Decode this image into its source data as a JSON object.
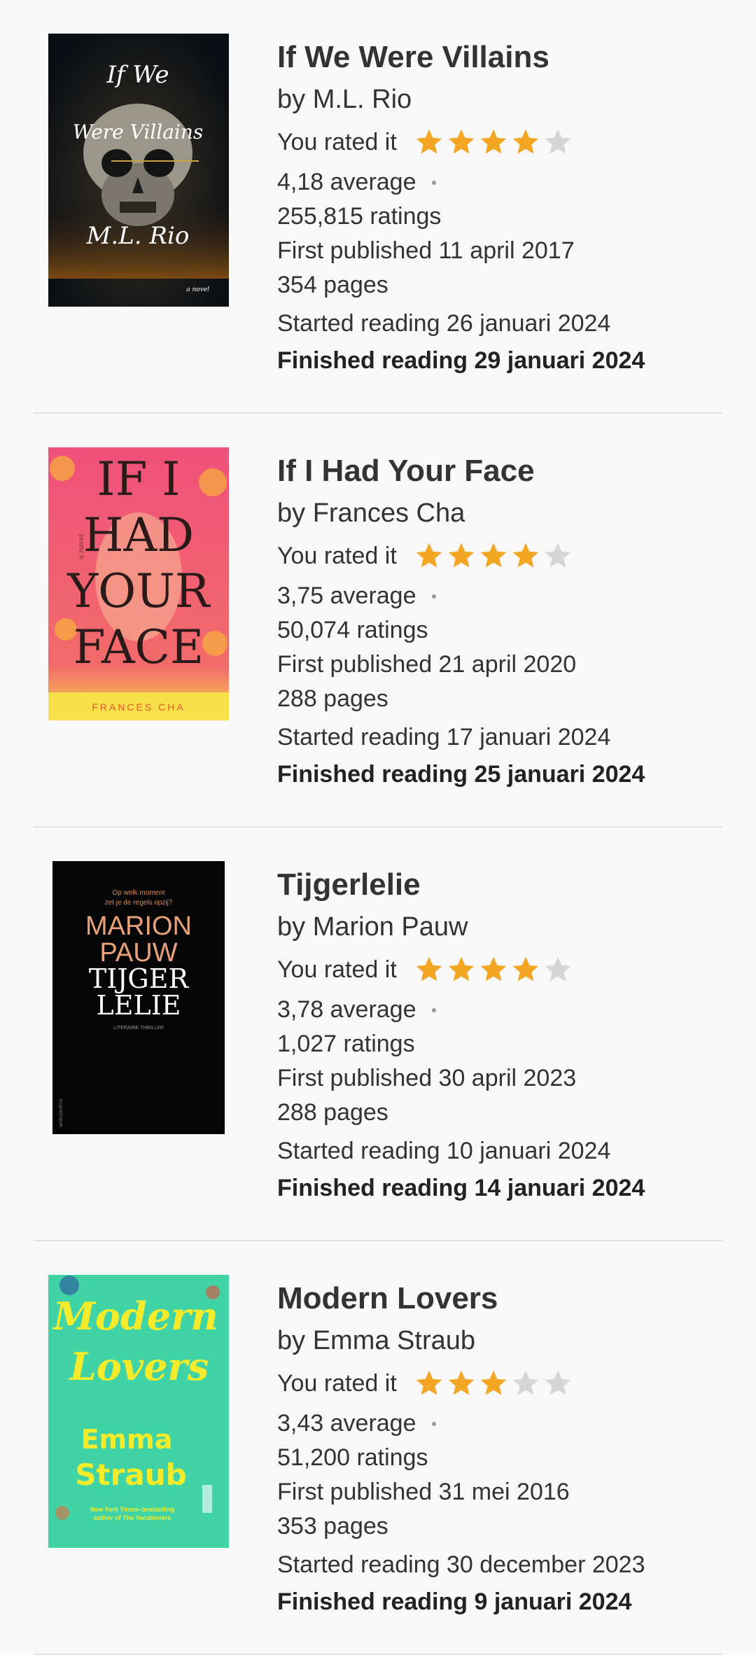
{
  "colors": {
    "star_filled": "#f2a623",
    "star_empty": "#d6d6d6",
    "divider": "#e3e3e3",
    "background": "#f8f8f8"
  },
  "books": [
    {
      "cover_text": [
        "If We",
        "Were Villains",
        "M.L. Rio",
        "a novel"
      ],
      "title": "If We Were Villains",
      "author": "by M.L. Rio",
      "rated_label": "You rated it",
      "rating": 4,
      "average": "4,18 average",
      "ratings": "255,815 ratings",
      "published": "First published 11 april 2017",
      "pages": "354 pages",
      "started": "Started reading 26 januari 2024",
      "finished": "Finished reading 29 januari 2024"
    },
    {
      "cover_text": [
        "IF I",
        "HAD",
        "YOUR",
        "FACE",
        "FRANCES CHA",
        "a novel"
      ],
      "title": "If I Had Your Face",
      "author": "by Frances Cha",
      "rated_label": "You rated it",
      "rating": 4,
      "average": "3,75 average",
      "ratings": "50,074 ratings",
      "published": "First published 21 april 2020",
      "pages": "288 pages",
      "started": "Started reading 17 januari 2024",
      "finished": "Finished reading 25 januari 2024"
    },
    {
      "cover_text": [
        "Op welk moment",
        "zet je de regels opzij?",
        "MARION",
        "PAUW",
        "TIJGER",
        "LELIE",
        "LITERAIRE THRILLER",
        "ambo|anthos"
      ],
      "title": "Tijgerlelie",
      "author": "by Marion Pauw",
      "rated_label": "You rated it",
      "rating": 4,
      "average": "3,78 average",
      "ratings": "1,027 ratings",
      "published": "First published 30 april 2023",
      "pages": "288 pages",
      "started": "Started reading 10 januari 2024",
      "finished": "Finished reading 14 januari 2024"
    },
    {
      "cover_text": [
        "Modern",
        "Lovers",
        "Emma",
        "Straub",
        "New York Times–bestselling",
        "author of The Vacationers"
      ],
      "title": "Modern Lovers",
      "author": "by Emma Straub",
      "rated_label": "You rated it",
      "rating": 3,
      "average": "3,43 average",
      "ratings": "51,200 ratings",
      "published": "First published 31 mei 2016",
      "pages": "353 pages",
      "started": "Started reading 30 december 2023",
      "finished": "Finished reading 9 januari 2024"
    }
  ]
}
